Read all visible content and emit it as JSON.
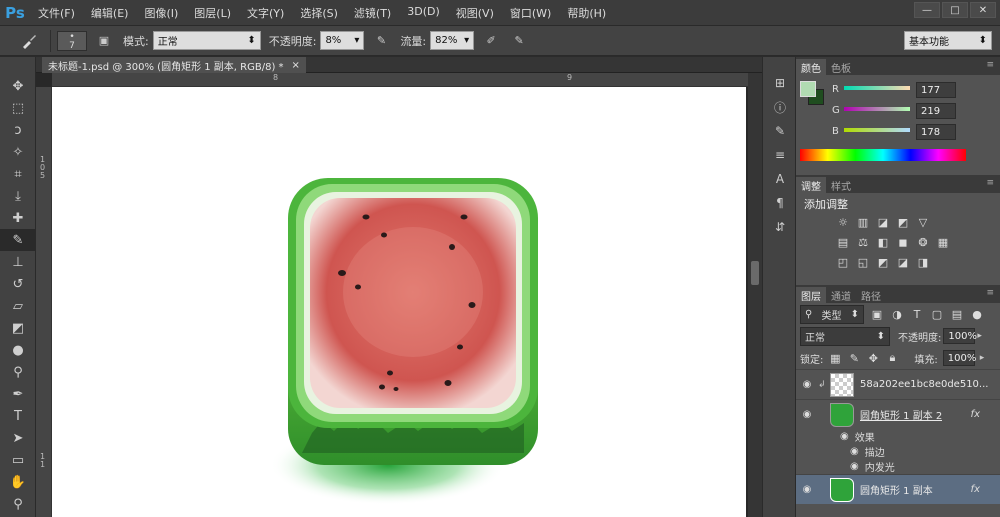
{
  "app": {
    "logo": "Ps"
  },
  "menu": [
    "文件(F)",
    "编辑(E)",
    "图像(I)",
    "图层(L)",
    "文字(Y)",
    "选择(S)",
    "滤镜(T)",
    "3D(D)",
    "视图(V)",
    "窗口(W)",
    "帮助(H)"
  ],
  "window_controls": {
    "minimize": "—",
    "restore": "□",
    "close": "✕"
  },
  "options": {
    "brush_size": "7",
    "mode_label": "模式:",
    "mode_value": "正常",
    "opacity_label": "不透明度:",
    "opacity_value": "8%",
    "flow_label": "流量:",
    "flow_value": "82%",
    "workspace": "基本功能"
  },
  "document": {
    "tab_title": "未标题-1.psd @ 300% (圆角矩形 1 副本, RGB/8) *",
    "close": "×",
    "ruler_h": [
      "8",
      "9"
    ],
    "ruler_v": [
      "1",
      "0",
      "5",
      "1",
      "1"
    ]
  },
  "color_panel": {
    "tabs": [
      "颜色",
      "色板"
    ],
    "r_label": "R",
    "r_value": "177",
    "g_label": "G",
    "g_value": "219",
    "b_label": "B",
    "b_value": "178",
    "foreground": "#b1dbb2",
    "background": "#1f4d1f"
  },
  "adjust_panel": {
    "tabs": [
      "调整",
      "样式"
    ],
    "title": "添加调整"
  },
  "layers_panel": {
    "tabs": [
      "图层",
      "通道",
      "路径"
    ],
    "filter": "类型",
    "blend": "正常",
    "opacity_label": "不透明度:",
    "opacity_value": "100%",
    "lock_label": "锁定:",
    "fill_label": "填充:",
    "fill_value": "100%",
    "layers": [
      {
        "name": "58a202ee1bc8e0de510...",
        "fx": ""
      },
      {
        "name": "圆角矩形 1 副本 2",
        "fx": "fx"
      },
      {
        "name": "圆角矩形 1 副本",
        "fx": "fx"
      }
    ],
    "effects_label": "效果",
    "effect_items": [
      "描边",
      "内发光"
    ]
  },
  "colors": {
    "ps_blue": "#3aa0e0",
    "watermelon_red": "#d65a55",
    "rind_green": "#4cb53c"
  }
}
